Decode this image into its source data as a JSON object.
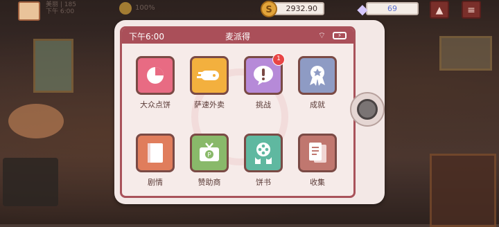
{
  "topbar": {
    "level": "美丽 | 185",
    "time_text": "下午 6:00",
    "satisfaction_pct": "100%",
    "coins": "2932.90",
    "coin_icon": "coin-icon",
    "coin_glyph": "S",
    "gems": "69",
    "gem_icon": "diamond-icon",
    "gem_glyph": "◆",
    "up_glyph": "▲",
    "menu_glyph": "≡"
  },
  "phone": {
    "status_time": "下午6:00",
    "app_title": "麦派得",
    "wifi_glyph": "⌔",
    "battery_glyph": "⚡",
    "accent_color": "#aa4f59",
    "apps": [
      {
        "label": "大众点饼",
        "icon": "pie-chart-icon",
        "color": "#e86b83"
      },
      {
        "label": "萨速外卖",
        "icon": "delivery-icon",
        "color": "#f3b03e"
      },
      {
        "label": "挑战",
        "icon": "exclamation-icon",
        "color": "#b68ad8",
        "badge": "1"
      },
      {
        "label": "成就",
        "icon": "medal-icon",
        "color": "#8e9bc4"
      },
      {
        "label": "剧情",
        "icon": "book-icon",
        "color": "#e07d5c"
      },
      {
        "label": "赞助商",
        "icon": "tv-icon",
        "color": "#89b96a"
      },
      {
        "label": "饼书",
        "icon": "film-reel-icon",
        "color": "#5fb8a0"
      },
      {
        "label": "收集",
        "icon": "cards-icon",
        "color": "#c0776f"
      }
    ]
  }
}
